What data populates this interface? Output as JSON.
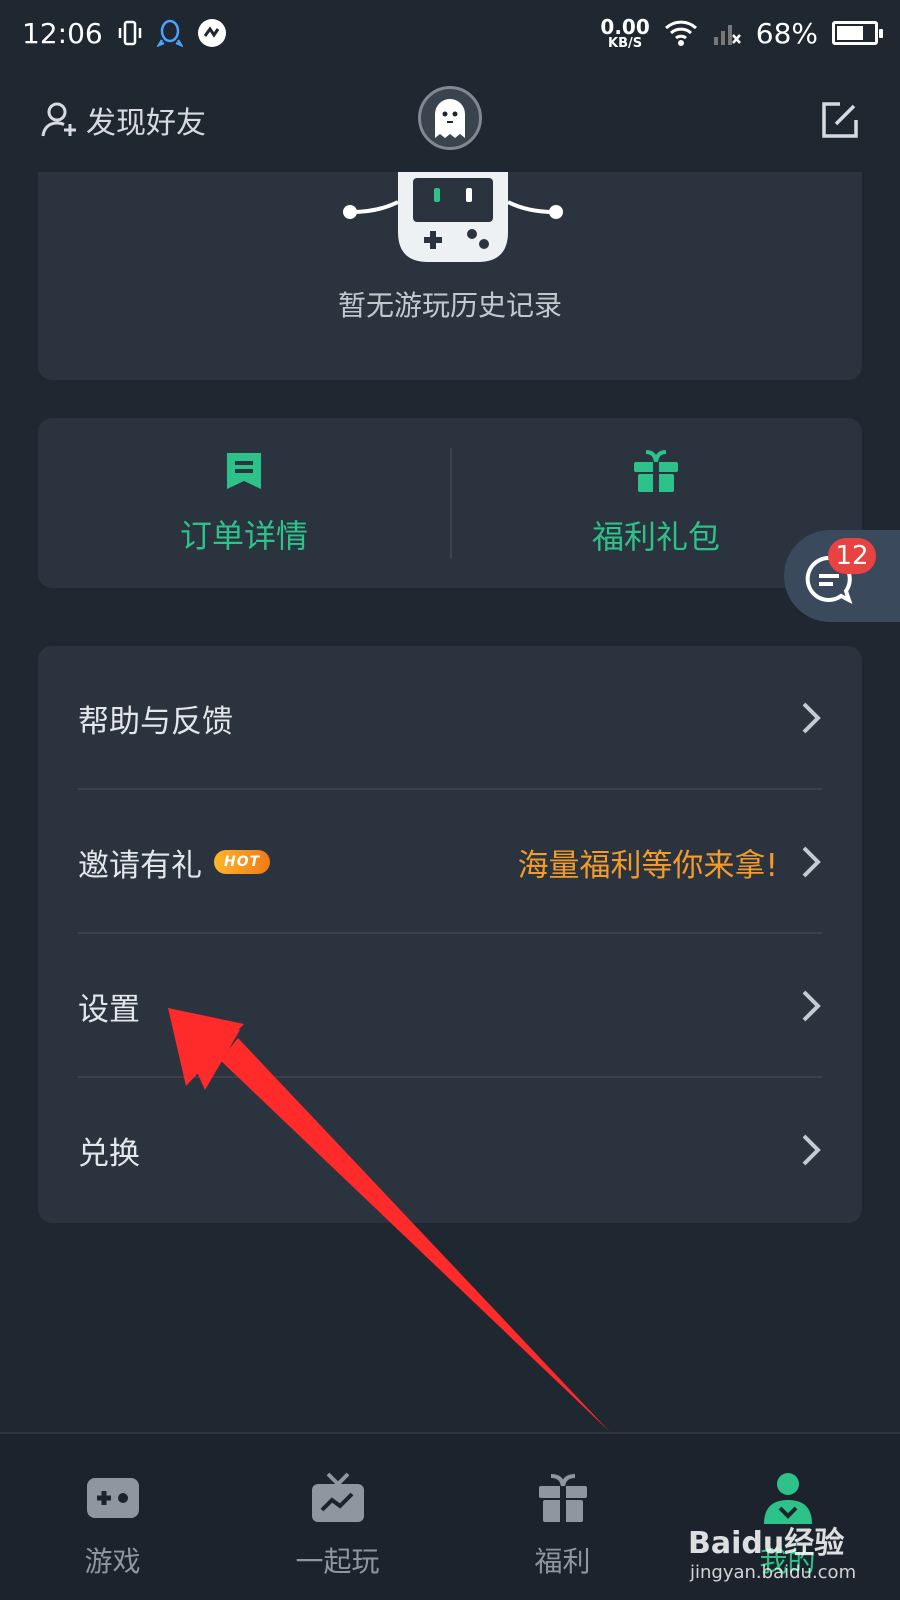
{
  "statusbar": {
    "time": "12:06",
    "net_speed_value": "0.00",
    "net_speed_unit": "KB/S",
    "battery_percent": "68%",
    "battery_level": 0.68
  },
  "header": {
    "find_friends_label": "发现好友"
  },
  "history": {
    "empty_text": "暂无游玩历史记录"
  },
  "quick_actions": [
    {
      "label": "订单详情",
      "icon": "order-details-icon"
    },
    {
      "label": "福利礼包",
      "icon": "gift-pack-icon"
    }
  ],
  "menu": [
    {
      "label": "帮助与反馈",
      "extra": ""
    },
    {
      "label": "邀请有礼",
      "badge": "HOT",
      "extra": "海量福利等你来拿!"
    },
    {
      "label": "设置",
      "extra": ""
    },
    {
      "label": "兑换",
      "extra": ""
    }
  ],
  "chat": {
    "badge_count": "12"
  },
  "tabbar": [
    {
      "label": "游戏",
      "icon": "gamepad-icon",
      "active": false
    },
    {
      "label": "一起玩",
      "icon": "tv-icon",
      "active": false
    },
    {
      "label": "福利",
      "icon": "gift-icon",
      "active": false
    },
    {
      "label": "我的",
      "icon": "profile-icon",
      "active": true
    }
  ],
  "watermark": {
    "brand": "Baidu经验",
    "url": "jingyan.baidu.com"
  },
  "colors": {
    "background": "#1f2731",
    "card": "#2a333e",
    "accent_green": "#2cc28a",
    "accent_orange": "#f29b2b",
    "badge_red": "#e94242",
    "arrow_red": "#ff2a2a"
  }
}
